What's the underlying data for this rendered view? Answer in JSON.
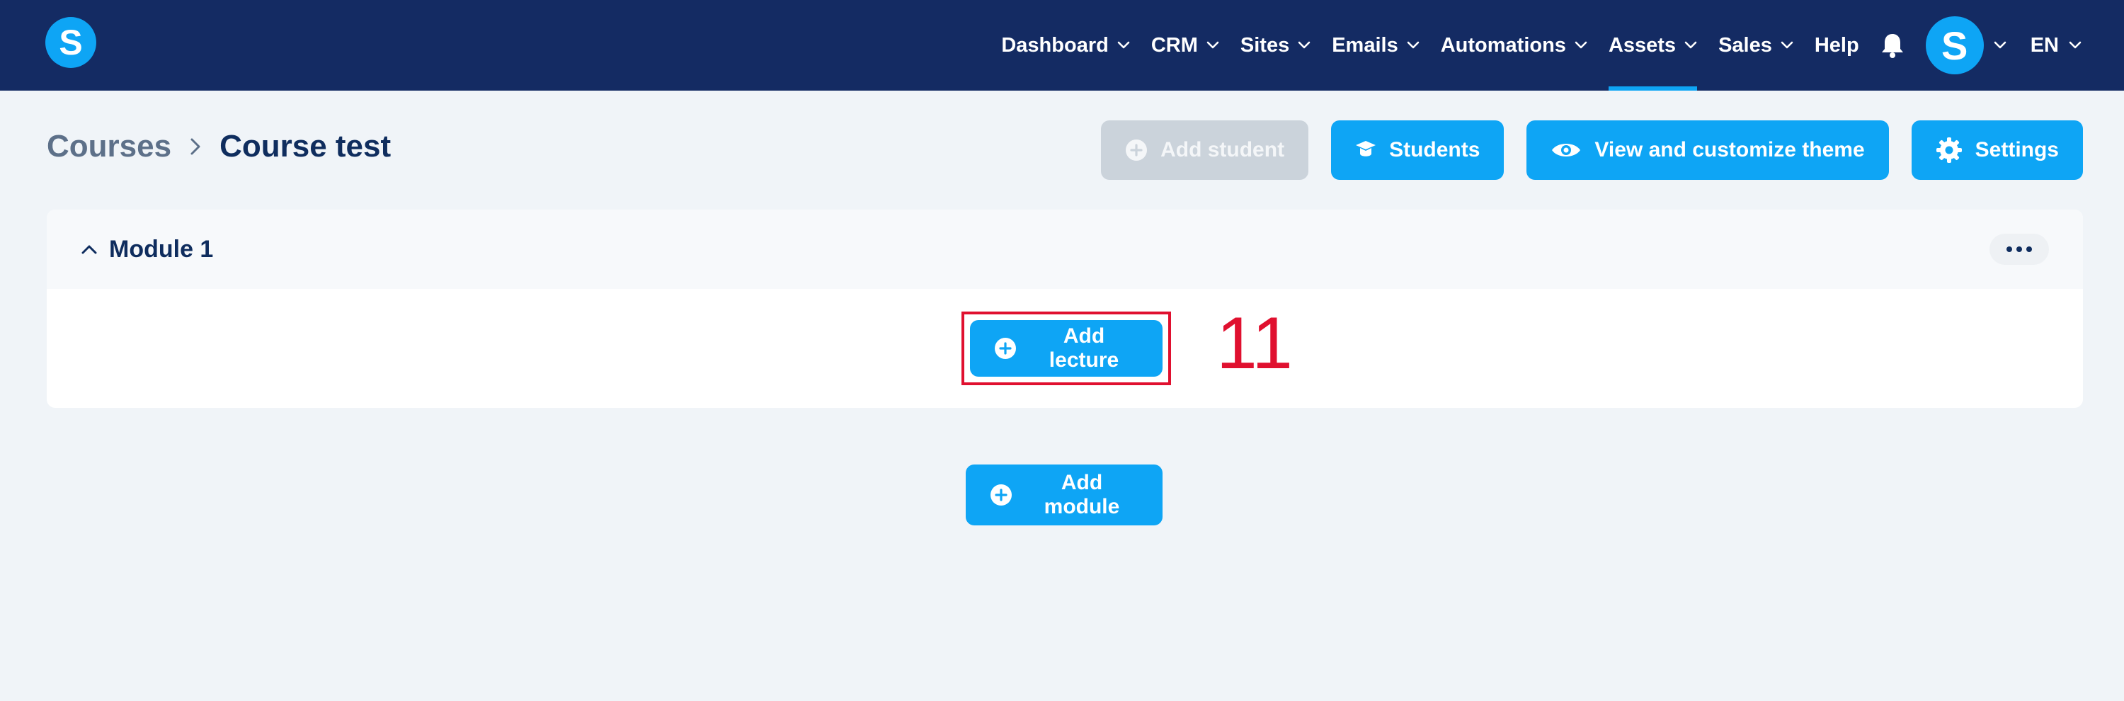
{
  "app": {
    "logo_letter": "S",
    "brand_color": "#0ea5f5",
    "nav_bg": "#142b63"
  },
  "nav": {
    "items": [
      {
        "label": "Dashboard",
        "has_dropdown": true
      },
      {
        "label": "CRM",
        "has_dropdown": true
      },
      {
        "label": "Sites",
        "has_dropdown": true
      },
      {
        "label": "Emails",
        "has_dropdown": true
      },
      {
        "label": "Automations",
        "has_dropdown": true
      },
      {
        "label": "Assets",
        "has_dropdown": true,
        "active": true
      },
      {
        "label": "Sales",
        "has_dropdown": true
      },
      {
        "label": "Help",
        "has_dropdown": false
      }
    ],
    "bell_icon": "bell-icon",
    "avatar_letter": "S",
    "language": "EN"
  },
  "breadcrumb": {
    "parent": "Courses",
    "current": "Course test"
  },
  "actions": {
    "add_student": "Add student",
    "students": "Students",
    "view_theme": "View and customize theme",
    "settings": "Settings"
  },
  "module": {
    "title": "Module 1",
    "add_lecture": "Add lecture"
  },
  "annotation": {
    "label": "11",
    "color": "#e0102f"
  },
  "add_module": "Add module"
}
